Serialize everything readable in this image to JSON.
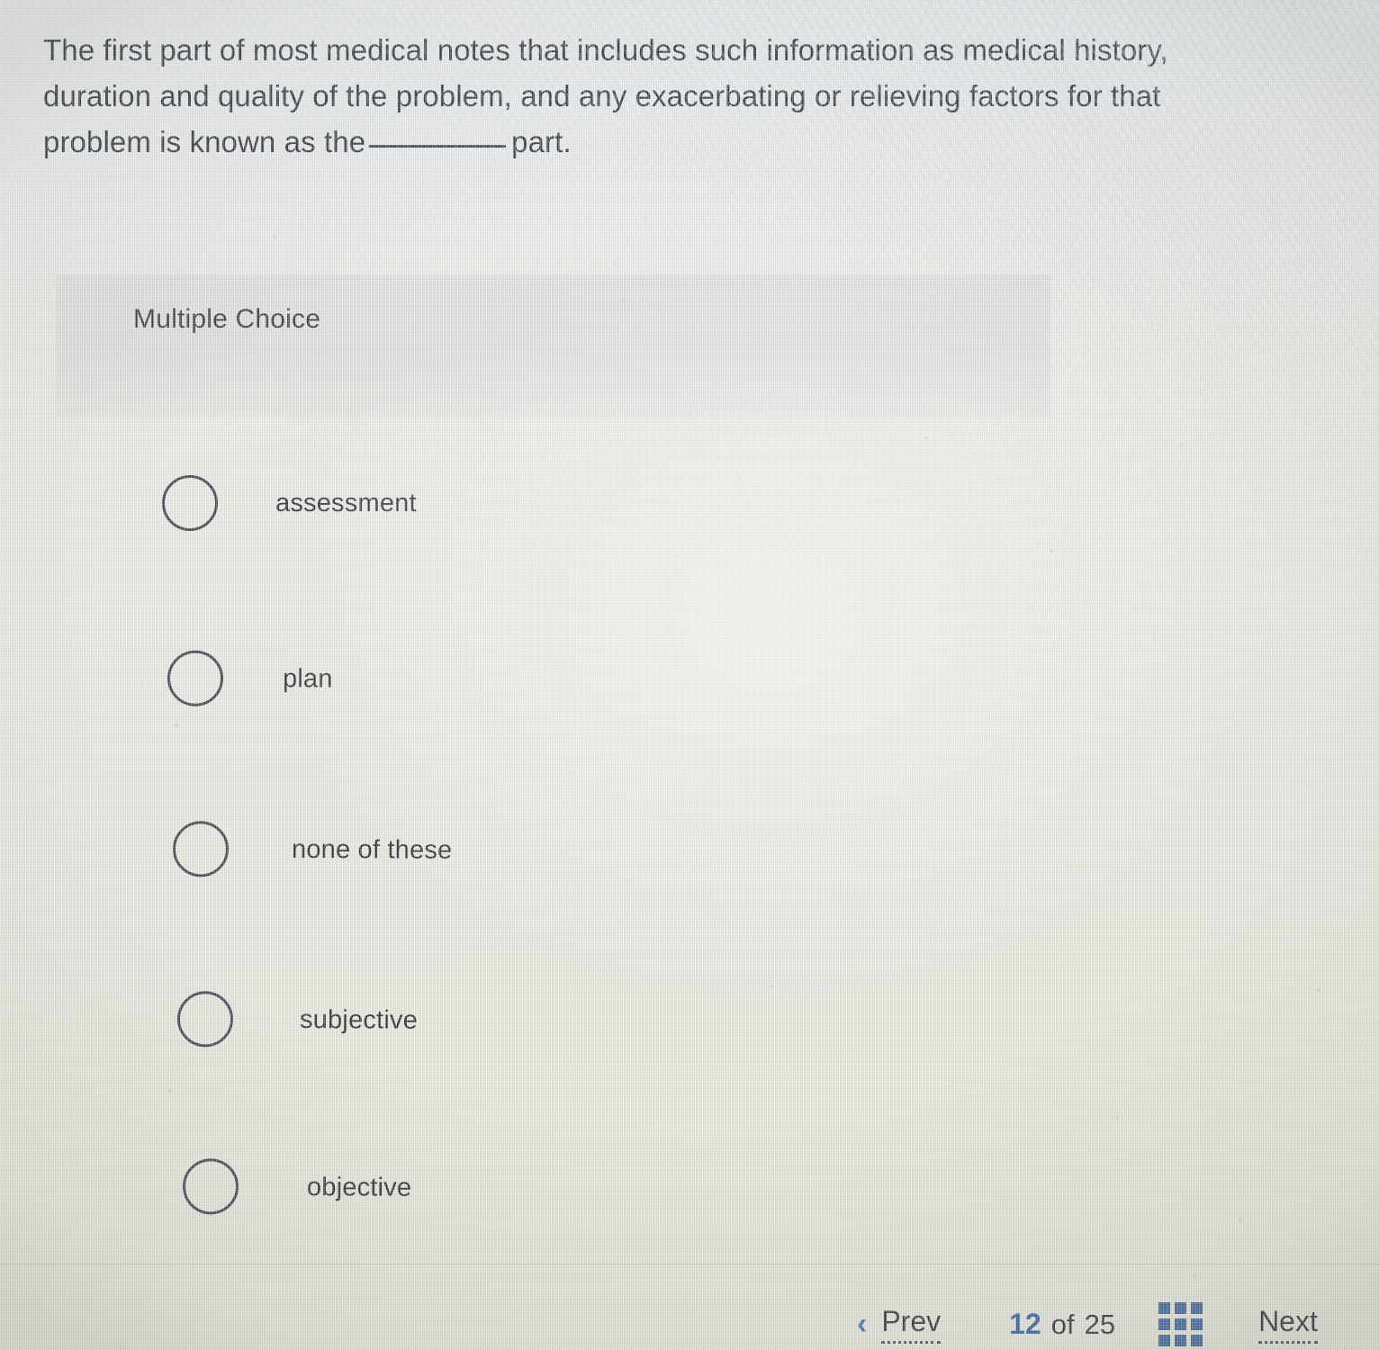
{
  "question": {
    "text_before_blank": "The first part of most medical notes that includes such information as medical history, duration and quality of the problem, and any exacerbating or relieving factors for that problem is known as the",
    "text_after_blank": "part."
  },
  "answer_section": {
    "type_label": "Multiple Choice",
    "options": [
      {
        "label": "assessment",
        "selected": false
      },
      {
        "label": "plan",
        "selected": false
      },
      {
        "label": "none of these",
        "selected": false
      },
      {
        "label": "subjective",
        "selected": false
      },
      {
        "label": "objective",
        "selected": false
      }
    ]
  },
  "navigation": {
    "prev_label": "Prev",
    "prev_icon": "chevron-left-icon",
    "current_page": "12",
    "of_label": "of",
    "total_pages": "25",
    "grid_icon": "grid-view-icon",
    "next_label": "Next"
  },
  "colors": {
    "accent_blue": "#3a63a0",
    "counter_blue": "#2f5d9e",
    "text_dark": "#2b2e34",
    "radio_outline": "#3a3f4c"
  }
}
